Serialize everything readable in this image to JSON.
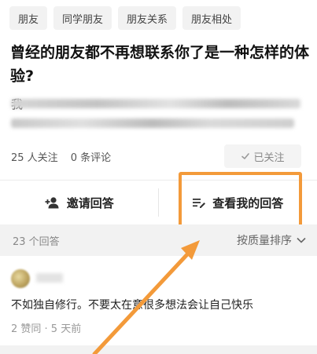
{
  "tags": [
    "朋友",
    "同学朋友",
    "朋友关系",
    "朋友相处"
  ],
  "question": {
    "title": "曾经的朋友都不再想联系你了是一种怎样的体验?",
    "excerpt_first_char": "我"
  },
  "stats": {
    "followers": "25 人关注",
    "comments": "0 条评论",
    "follow_button": "已关注"
  },
  "actions": {
    "invite": "邀请回答",
    "view_mine": "查看我的回答"
  },
  "answers_bar": {
    "count": "23 个回答",
    "sort": "按质量排序"
  },
  "answer": {
    "text": "不如独自修行。不要太在意很多想法会让自己快乐",
    "meta": "2 赞同 · 5 天前"
  },
  "colors": {
    "highlight": "#f39a3a",
    "arrow": "#f39a3a"
  },
  "icons": {
    "follow_check": "check-icon",
    "invite": "add-person-icon",
    "view_mine": "list-edit-icon",
    "sort": "chevron-down-icon"
  }
}
